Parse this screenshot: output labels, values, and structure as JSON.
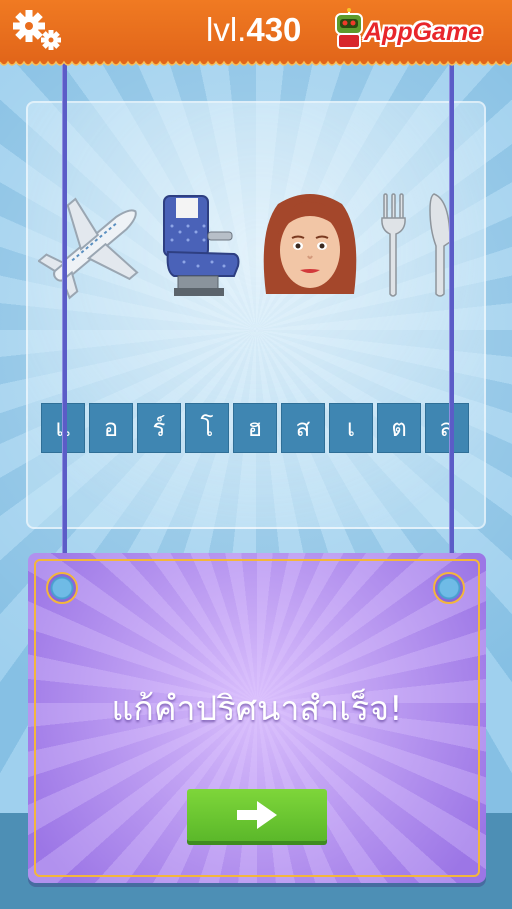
{
  "header": {
    "level_prefix": "lvl.",
    "level_number": "430",
    "brand": "AppGame",
    "settings_icon": "gears-icon",
    "brand_icon": "robot-mascot-icon",
    "bar_color": "#e96d1e"
  },
  "puzzle": {
    "emojis": [
      "airplane-icon",
      "airplane-seat-icon",
      "woman-face-icon",
      "fork-knife-icon"
    ],
    "answer_letters": [
      "แ",
      "อ",
      "ร์",
      "โ",
      "ฮ",
      "ส",
      "เ",
      "ต",
      "ส"
    ]
  },
  "result": {
    "message": "แก้คำปริศนาสำเร็จ!",
    "next_icon": "right-arrow-icon",
    "button_color": "#6cc832"
  }
}
